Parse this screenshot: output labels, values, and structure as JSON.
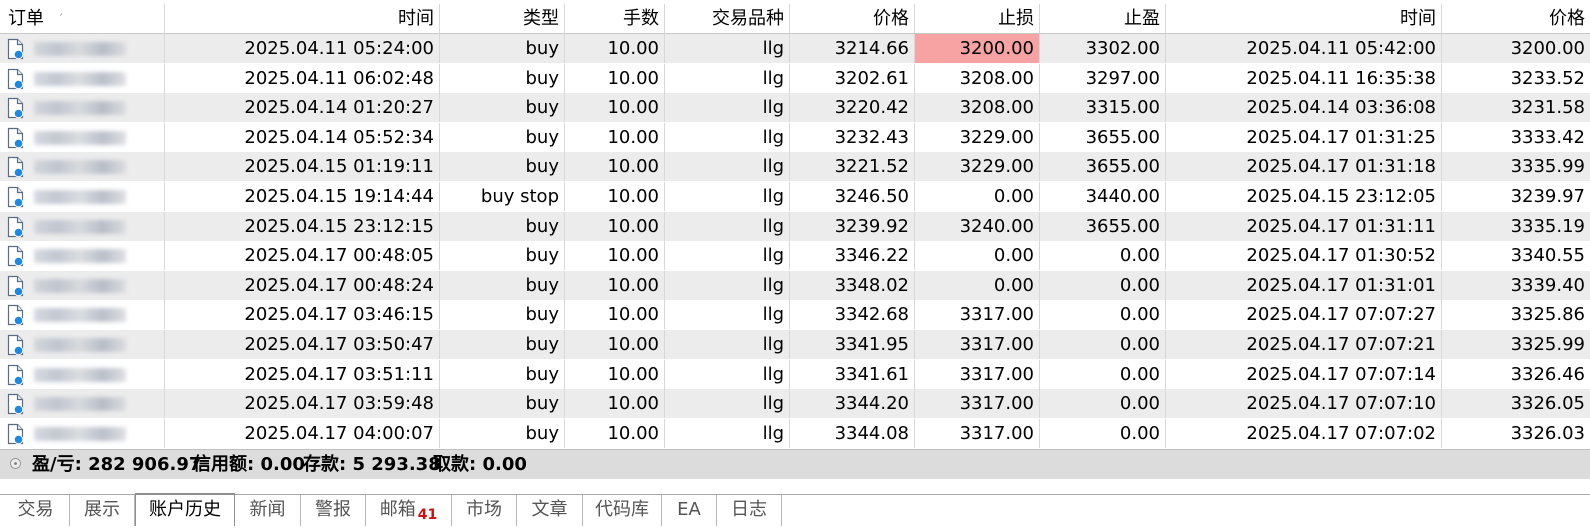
{
  "columns": [
    "订单",
    "时间",
    "类型",
    "手数",
    "交易品种",
    "价格",
    "止损",
    "止盈",
    "时间",
    "价格"
  ],
  "sort_mark": "ˊ",
  "rows": [
    {
      "open_time": "2025.04.11 05:24:00",
      "type": "buy",
      "lots": "10.00",
      "symbol": "llg",
      "price": "3214.66",
      "sl": "3200.00",
      "tp": "3302.00",
      "close_time": "2025.04.11 05:42:00",
      "close_price": "3200.00",
      "sl_hit": true
    },
    {
      "open_time": "2025.04.11 06:02:48",
      "type": "buy",
      "lots": "10.00",
      "symbol": "llg",
      "price": "3202.61",
      "sl": "3208.00",
      "tp": "3297.00",
      "close_time": "2025.04.11 16:35:38",
      "close_price": "3233.52"
    },
    {
      "open_time": "2025.04.14 01:20:27",
      "type": "buy",
      "lots": "10.00",
      "symbol": "llg",
      "price": "3220.42",
      "sl": "3208.00",
      "tp": "3315.00",
      "close_time": "2025.04.14 03:36:08",
      "close_price": "3231.58"
    },
    {
      "open_time": "2025.04.14 05:52:34",
      "type": "buy",
      "lots": "10.00",
      "symbol": "llg",
      "price": "3232.43",
      "sl": "3229.00",
      "tp": "3655.00",
      "close_time": "2025.04.17 01:31:25",
      "close_price": "3333.42"
    },
    {
      "open_time": "2025.04.15 01:19:11",
      "type": "buy",
      "lots": "10.00",
      "symbol": "llg",
      "price": "3221.52",
      "sl": "3229.00",
      "tp": "3655.00",
      "close_time": "2025.04.17 01:31:18",
      "close_price": "3335.99"
    },
    {
      "open_time": "2025.04.15 19:14:44",
      "type": "buy stop",
      "lots": "10.00",
      "symbol": "llg",
      "price": "3246.50",
      "sl": "0.00",
      "tp": "3440.00",
      "close_time": "2025.04.15 23:12:05",
      "close_price": "3239.97"
    },
    {
      "open_time": "2025.04.15 23:12:15",
      "type": "buy",
      "lots": "10.00",
      "symbol": "llg",
      "price": "3239.92",
      "sl": "3240.00",
      "tp": "3655.00",
      "close_time": "2025.04.17 01:31:11",
      "close_price": "3335.19"
    },
    {
      "open_time": "2025.04.17 00:48:05",
      "type": "buy",
      "lots": "10.00",
      "symbol": "llg",
      "price": "3346.22",
      "sl": "0.00",
      "tp": "0.00",
      "close_time": "2025.04.17 01:30:52",
      "close_price": "3340.55"
    },
    {
      "open_time": "2025.04.17 00:48:24",
      "type": "buy",
      "lots": "10.00",
      "symbol": "llg",
      "price": "3348.02",
      "sl": "0.00",
      "tp": "0.00",
      "close_time": "2025.04.17 01:31:01",
      "close_price": "3339.40"
    },
    {
      "open_time": "2025.04.17 03:46:15",
      "type": "buy",
      "lots": "10.00",
      "symbol": "llg",
      "price": "3342.68",
      "sl": "3317.00",
      "tp": "0.00",
      "close_time": "2025.04.17 07:07:27",
      "close_price": "3325.86"
    },
    {
      "open_time": "2025.04.17 03:50:47",
      "type": "buy",
      "lots": "10.00",
      "symbol": "llg",
      "price": "3341.95",
      "sl": "3317.00",
      "tp": "0.00",
      "close_time": "2025.04.17 07:07:21",
      "close_price": "3325.99"
    },
    {
      "open_time": "2025.04.17 03:51:11",
      "type": "buy",
      "lots": "10.00",
      "symbol": "llg",
      "price": "3341.61",
      "sl": "3317.00",
      "tp": "0.00",
      "close_time": "2025.04.17 07:07:14",
      "close_price": "3326.46"
    },
    {
      "open_time": "2025.04.17 03:59:48",
      "type": "buy",
      "lots": "10.00",
      "symbol": "llg",
      "price": "3344.20",
      "sl": "3317.00",
      "tp": "0.00",
      "close_time": "2025.04.17 07:07:10",
      "close_price": "3326.05"
    },
    {
      "open_time": "2025.04.17 04:00:07",
      "type": "buy",
      "lots": "10.00",
      "symbol": "llg",
      "price": "3344.08",
      "sl": "3317.00",
      "tp": "0.00",
      "close_time": "2025.04.17 07:07:02",
      "close_price": "3326.03"
    }
  ],
  "status": {
    "profit_label": "盈/亏:",
    "profit": "282 906.97",
    "credit_label": "信用额:",
    "credit": "0.00",
    "deposit_label": "存款:",
    "deposit": "5 293.38",
    "withdrawal_label": "取款:",
    "withdrawal": "0.00"
  },
  "tabs": [
    {
      "label": "交易"
    },
    {
      "label": "展示"
    },
    {
      "label": "账户历史",
      "active": true
    },
    {
      "label": "新闻"
    },
    {
      "label": "警报"
    },
    {
      "label": "邮箱",
      "badge": "41"
    },
    {
      "label": "市场"
    },
    {
      "label": "文章"
    },
    {
      "label": "代码库"
    },
    {
      "label": "EA"
    },
    {
      "label": "日志"
    }
  ],
  "colors": {
    "row_alt": "#ececec",
    "sl_highlight": "#f7a3a3",
    "badge": "#d01010",
    "status_bar": "#dcdcdc"
  },
  "icons": {
    "order_row": "document-blue-dot-icon",
    "status": "status-dot-icon"
  }
}
